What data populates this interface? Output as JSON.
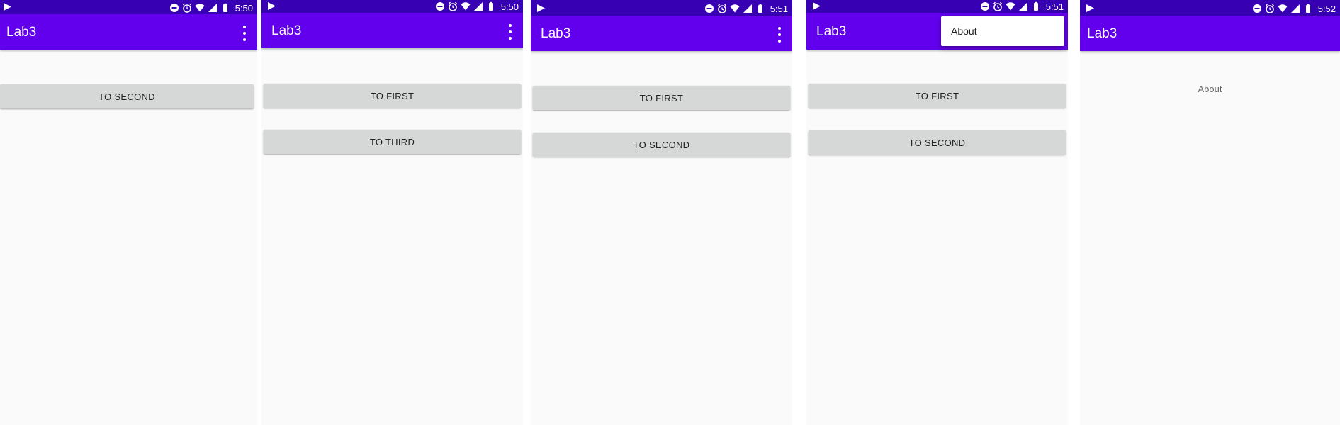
{
  "status_icon_names": [
    "dnd-icon",
    "alarm-icon",
    "wifi-icon",
    "signal-icon",
    "battery-icon"
  ],
  "screens": [
    {
      "clock": "5:50",
      "title": "Lab3",
      "buttons": [
        "TO SECOND"
      ]
    },
    {
      "clock": "5:50",
      "title": "Lab3",
      "buttons": [
        "TO FIRST",
        "TO THIRD"
      ]
    },
    {
      "clock": "5:51",
      "title": "Lab3",
      "buttons": [
        "TO FIRST",
        "TO SECOND"
      ]
    },
    {
      "clock": "5:51",
      "title": "Lab3",
      "buttons": [
        "TO FIRST",
        "TO SECOND"
      ],
      "overflow_menu": [
        "About"
      ]
    },
    {
      "clock": "5:52",
      "title": "Lab3",
      "body_text": "About"
    }
  ],
  "colors": {
    "status_bar": "#3700b3",
    "app_bar": "#6200ee",
    "background": "#fafafa",
    "button": "#d6d7d7"
  }
}
